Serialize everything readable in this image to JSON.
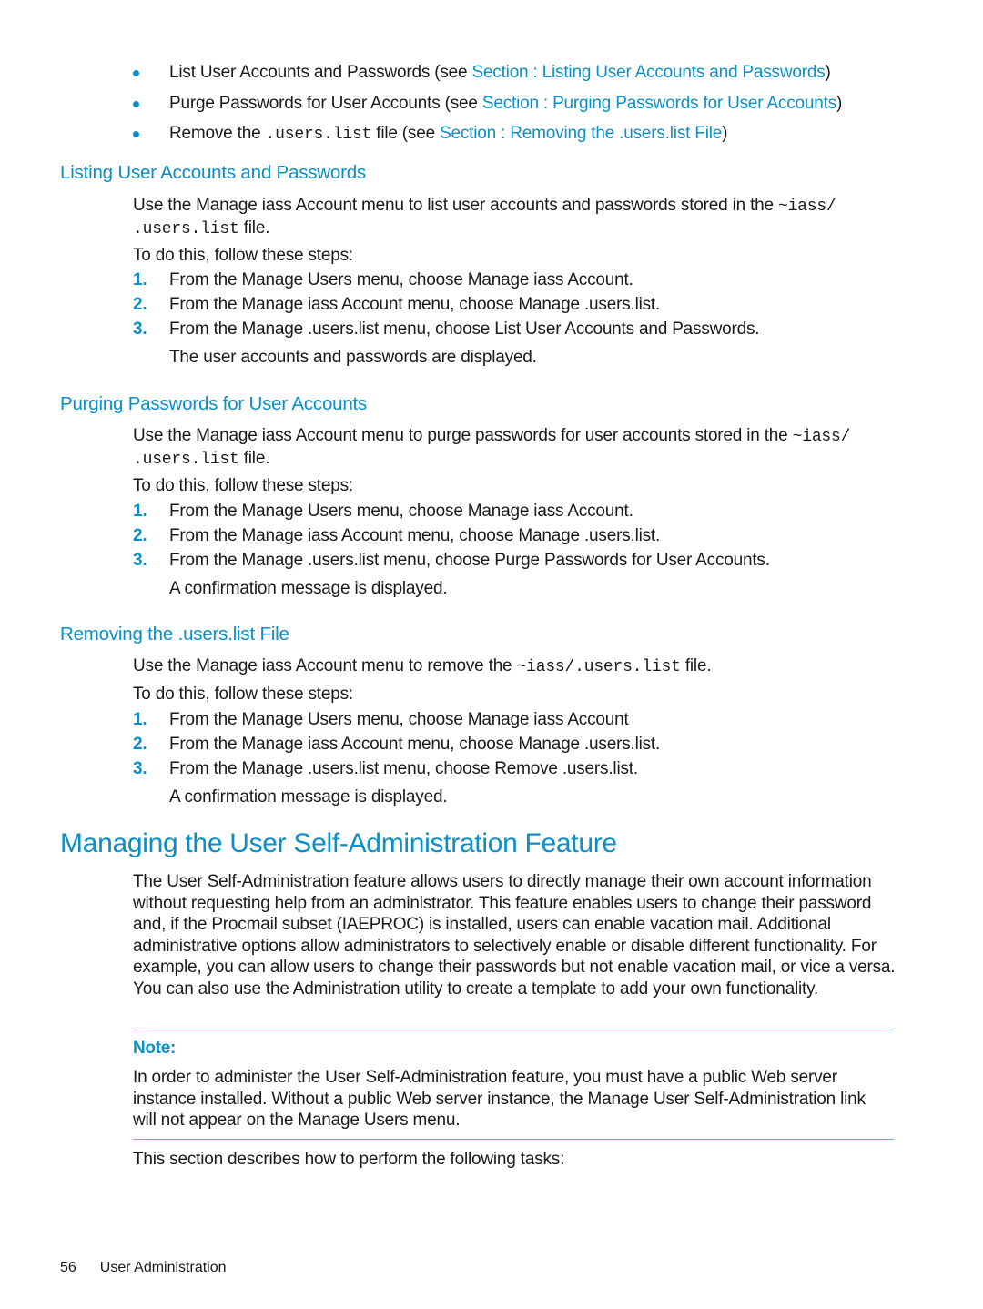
{
  "colors": {
    "accent": "#0a8fc8",
    "text": "#1a1a1a",
    "rule": "#5bb8dc"
  },
  "task_list": [
    {
      "prefix": "List User Accounts and Passwords (see ",
      "code": "",
      "mid": "",
      "link": "Section : Listing User Accounts and Passwords",
      "suffix": ")"
    },
    {
      "prefix": "Purge Passwords for User Accounts (see ",
      "code": "",
      "mid": "",
      "link": "Section : Purging Passwords for User Accounts",
      "suffix": ")"
    },
    {
      "prefix": "Remove the ",
      "code": ".users.list",
      "mid": " file (see ",
      "link": "Section : Removing the .users.list File",
      "suffix": ")"
    }
  ],
  "sections": {
    "listing": {
      "heading": "Listing User Accounts and Passwords",
      "intro_text": "Use the Manage iass Account menu to list user accounts and passwords stored in the ",
      "intro_code1": "~iass/",
      "intro_code2": ".users.list",
      "intro_tail": " file.",
      "lead": "To do this, follow these steps:",
      "steps": [
        {
          "num": "1.",
          "text": "From the Manage Users menu, choose Manage iass Account."
        },
        {
          "num": "2.",
          "text": "From the Manage iass Account menu, choose Manage .users.list."
        },
        {
          "num": "3.",
          "text": "From the Manage .users.list menu, choose List User Accounts and Passwords."
        }
      ],
      "result": "The user accounts and passwords are displayed."
    },
    "purging": {
      "heading": "Purging Passwords for User Accounts",
      "intro_text": "Use the Manage iass Account menu to purge passwords for user accounts stored in the ",
      "intro_code1": "~iass/",
      "intro_code2": ".users.list",
      "intro_tail": " file.",
      "lead": "To do this, follow these steps:",
      "steps": [
        {
          "num": "1.",
          "text": "From the Manage Users menu, choose Manage iass Account."
        },
        {
          "num": "2.",
          "text": "From the Manage iass Account menu, choose Manage .users.list."
        },
        {
          "num": "3.",
          "text": "From the Manage .users.list menu, choose Purge Passwords for User Accounts."
        }
      ],
      "result": "A confirmation message is displayed."
    },
    "removing": {
      "heading": "Removing the .users.list File",
      "intro_text": "Use the Manage iass Account menu to remove the ",
      "intro_code": "~iass/.users.list",
      "intro_tail": " file.",
      "lead": "To do this, follow these steps:",
      "steps": [
        {
          "num": "1.",
          "text": "From the Manage Users menu, choose Manage iass Account"
        },
        {
          "num": "2.",
          "text": "From the Manage iass Account menu, choose Manage .users.list."
        },
        {
          "num": "3.",
          "text": "From the Manage .users.list menu, choose Remove .users.list."
        }
      ],
      "result": "A confirmation message is displayed."
    }
  },
  "self_admin": {
    "heading": "Managing the User Self-Administration Feature",
    "body": "The User Self-Administration feature allows users to directly manage their own account information without requesting help from an administrator. This feature enables users to change their password and, if the Procmail subset (IAEPROC) is installed, users can enable vacation mail. Additional administrative options allow administrators to selectively enable or disable different functionality. For example, you can allow users to change their passwords but not enable vacation mail, or vice a versa. You can also use the Administration utility to create a template to add your own functionality.",
    "note_label": "Note:",
    "note_body": "In order to administer the User Self-Administration feature, you must have a public Web server instance installed. Without a public Web server instance, the Manage User Self-Administration link will not appear on the Manage Users menu.",
    "tasks_lead": "This section describes how to perform the following tasks:"
  },
  "footer": {
    "page_number": "56",
    "chapter": "User Administration"
  }
}
